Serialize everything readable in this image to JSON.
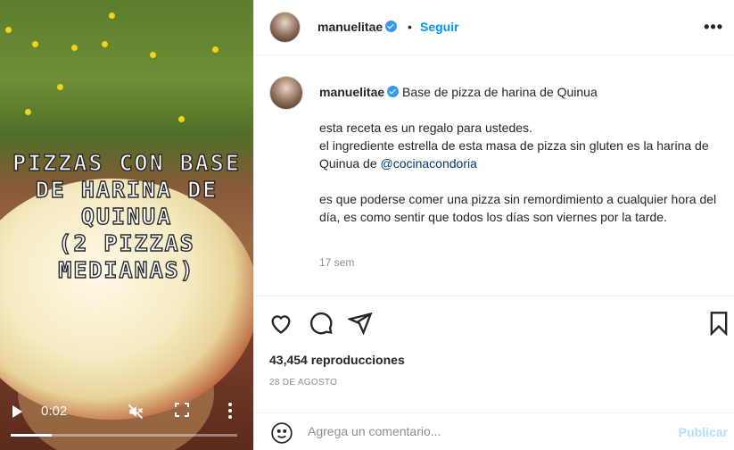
{
  "video": {
    "overlay_text": "PIZZAS CON BASE\nDE HARINA DE\nQUINUA\n(2 PIZZAS\nMEDIANAS)",
    "time": "0:02",
    "progress": 0.18
  },
  "header": {
    "username": "manuelitae",
    "separator": "•",
    "follow_label": "Seguir",
    "more_label": "•••"
  },
  "caption": {
    "username": "manuelitae",
    "title": "Base de pizza de harina de Quinua",
    "line1": "esta receta es un regalo para ustedes.",
    "line2_prefix": "el ingrediente estrella de esta masa de pizza sin gluten es la harina de Quinua de ",
    "mention": "@cocinacondoria",
    "para2": "es que poderse comer una pizza sin remordimiento a cualquier hora del día, es como sentir que todos los días son viernes por la tarde.",
    "time_ago": "17 sem"
  },
  "stats": {
    "views": "43,454 reproducciones",
    "date": "28 DE AGOSTO"
  },
  "comment": {
    "placeholder": "Agrega un comentario...",
    "publish_label": "Publicar"
  },
  "colors": {
    "accent": "#0095f6",
    "publish_disabled": "#b2dffc",
    "muted": "#8e8e8e"
  }
}
